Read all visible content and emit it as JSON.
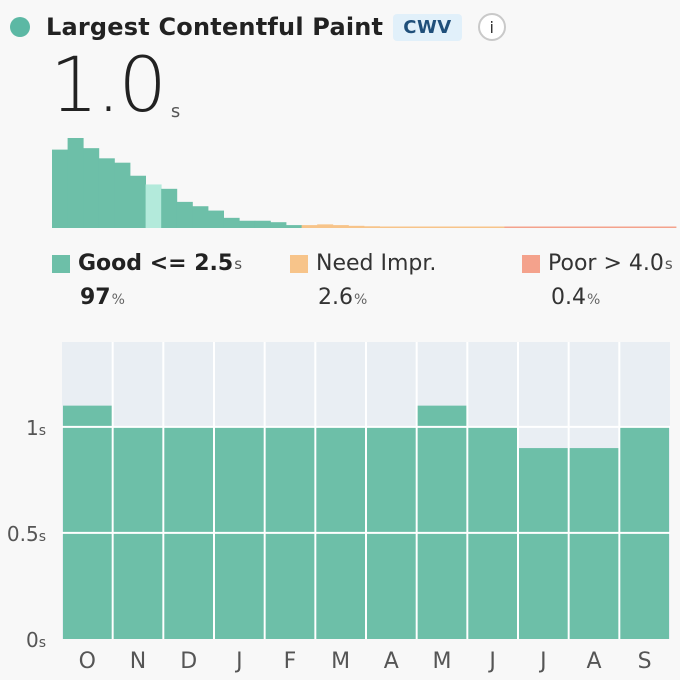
{
  "header": {
    "title": "Largest Contentful Paint",
    "badge": "CWV",
    "info_label": "i",
    "status_icon": "status-dot-icon",
    "info_icon": "info-icon"
  },
  "metric": {
    "value": "1.0",
    "unit": "s"
  },
  "colors": {
    "good": "#6dbfa8",
    "good_highlight": "#b3eadb",
    "needs_improvement": "#f7c48a",
    "poor": "#f4a28c",
    "status_dot": "#5cb8a4",
    "plot_bg": "#e9eef3"
  },
  "legend": {
    "good": {
      "label": "Good <= 2.5",
      "unit": "s",
      "pct": "97",
      "pct_unit": "%"
    },
    "needs_improvement": {
      "label": "Need Impr.",
      "pct": "2.6",
      "pct_unit": "%"
    },
    "poor": {
      "label": "Poor > 4.0",
      "unit": "s",
      "pct": "0.4",
      "pct_unit": "%"
    }
  },
  "chart_data": [
    {
      "type": "bar",
      "title": "",
      "xlabel": "",
      "ylabel": "",
      "highlight_index": 6,
      "bins": [
        {
          "good": 0.54
        },
        {
          "good": 0.62
        },
        {
          "good": 0.55
        },
        {
          "good": 0.48
        },
        {
          "good": 0.45
        },
        {
          "good": 0.36
        },
        {
          "good": 0.3
        },
        {
          "good": 0.27
        },
        {
          "good": 0.18
        },
        {
          "good": 0.15
        },
        {
          "good": 0.12
        },
        {
          "good": 0.07
        },
        {
          "good": 0.05
        },
        {
          "good": 0.05
        },
        {
          "good": 0.04
        },
        {
          "good": 0.02
        },
        {
          "needs_improvement": 0.02
        },
        {
          "needs_improvement": 0.025
        },
        {
          "needs_improvement": 0.02
        },
        {
          "needs_improvement": 0.015
        },
        {
          "needs_improvement": 0.012
        },
        {
          "needs_improvement": 0.01
        },
        {
          "needs_improvement": 0.01
        },
        {
          "needs_improvement": 0.008
        },
        {
          "needs_improvement": 0.008
        },
        {
          "needs_improvement": 0.007
        },
        {
          "needs_improvement": 0.006
        },
        {
          "needs_improvement": 0.006
        },
        {
          "needs_improvement": 0.005
        },
        {
          "poor": 0.005
        },
        {
          "poor": 0.005
        },
        {
          "poor": 0.005
        },
        {
          "poor": 0.005
        },
        {
          "poor": 0.005
        },
        {
          "poor": 0.005
        },
        {
          "poor": 0.005
        },
        {
          "poor": 0.005
        },
        {
          "poor": 0.005
        },
        {
          "poor": 0.005
        },
        {
          "poor": 0.005
        }
      ]
    },
    {
      "type": "bar",
      "title": "",
      "xlabel": "",
      "ylabel": "",
      "categories": [
        "O",
        "N",
        "D",
        "J",
        "F",
        "M",
        "A",
        "M",
        "J",
        "J",
        "A",
        "S"
      ],
      "values": [
        1.1,
        1.0,
        1.0,
        1.0,
        1.0,
        1.0,
        1.0,
        1.1,
        1.0,
        0.9,
        0.9,
        1.0
      ],
      "ylim": [
        0,
        1.4
      ],
      "yticks": [
        {
          "value": 0,
          "label": "0",
          "unit": "s"
        },
        {
          "value": 0.5,
          "label": "0.5",
          "unit": "s"
        },
        {
          "value": 1,
          "label": "1",
          "unit": "s"
        }
      ],
      "grid": true
    }
  ]
}
